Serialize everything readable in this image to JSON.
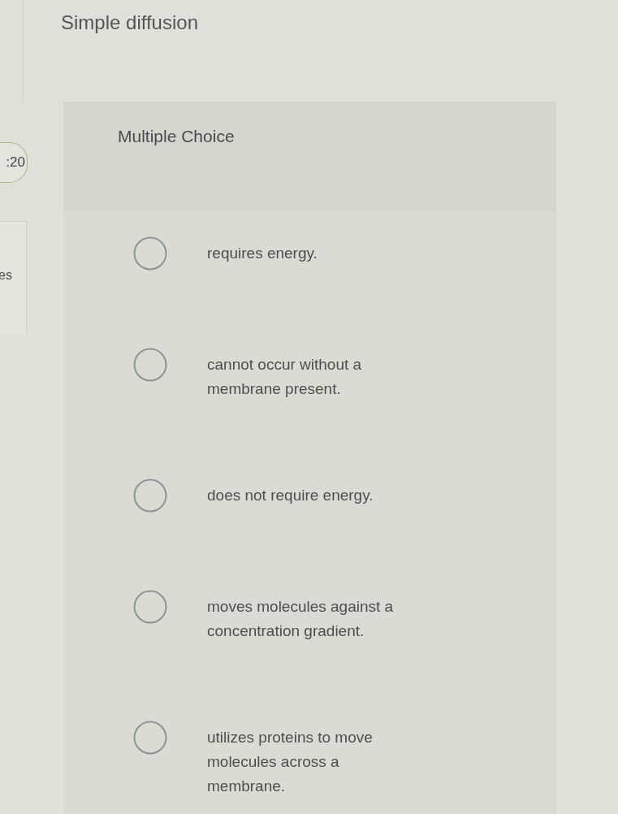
{
  "side_panel": {
    "badge": ":20",
    "label": "es"
  },
  "question": {
    "title": "Simple diffusion",
    "type_label": "Multiple Choice"
  },
  "options": [
    {
      "text": "requires energy.",
      "selected": false
    },
    {
      "text": "cannot occur without a membrane present.",
      "selected": false
    },
    {
      "text": "does not require energy.",
      "selected": false
    },
    {
      "text": "moves molecules against a concentration gradient.",
      "selected": false
    },
    {
      "text": "utilizes proteins to move molecules across a membrane.",
      "selected": false
    }
  ]
}
